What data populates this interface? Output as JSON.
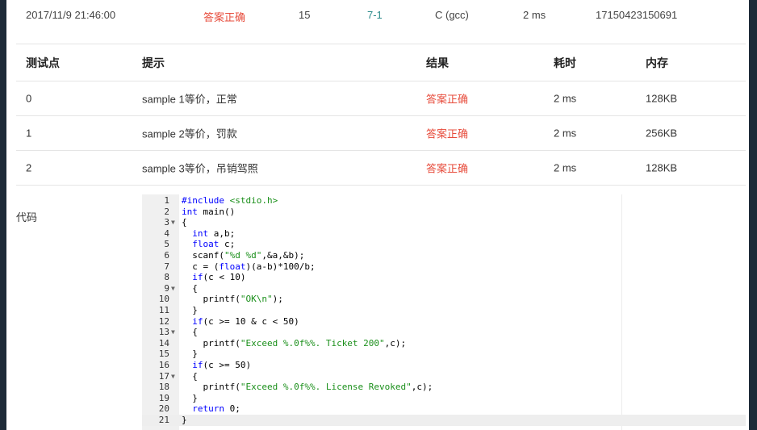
{
  "summary": {
    "time": "2017/11/9 21:46:00",
    "status": "答案正确",
    "score": "15",
    "problem": "7-1",
    "compiler": "C (gcc)",
    "duration": "2 ms",
    "submission_id": "17150423150691"
  },
  "cases": {
    "headers": [
      "测试点",
      "提示",
      "结果",
      "耗时",
      "内存"
    ],
    "rows": [
      {
        "id": "0",
        "hint": "sample 1等价，正常",
        "result": "答案正确",
        "time": "2 ms",
        "memory": "128KB"
      },
      {
        "id": "1",
        "hint": "sample 2等价，罚款",
        "result": "答案正确",
        "time": "2 ms",
        "memory": "256KB"
      },
      {
        "id": "2",
        "hint": "sample 3等价，吊销驾照",
        "result": "答案正确",
        "time": "2 ms",
        "memory": "128KB"
      }
    ]
  },
  "code": {
    "label": "代码",
    "lines": [
      "#include <stdio.h>",
      "int main()",
      "{",
      "  int a,b;",
      "  float c;",
      "  scanf(\"%d %d\",&a,&b);",
      "  c = (float)(a-b)*100/b;",
      "  if(c < 10)",
      "  {",
      "    printf(\"OK\\n\");",
      "  }",
      "  if(c >= 10 & c < 50)",
      "  {",
      "    printf(\"Exceed %.0f%%. Ticket 200\",c);",
      "  }",
      "  if(c >= 50)",
      "  {",
      "    printf(\"Exceed %.0f%%. License Revoked\",c);",
      "  }",
      "  return 0;",
      "}"
    ],
    "fold_lines": [
      3,
      9,
      13,
      17
    ],
    "active_line": 21
  }
}
